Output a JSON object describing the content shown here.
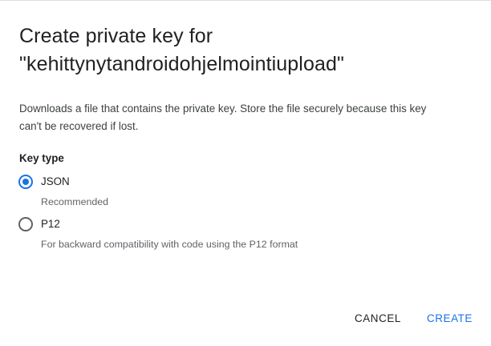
{
  "dialog": {
    "title_line1": "Create private key for",
    "title_line2": "\"kehittynytandroidohjelmointiupload\"",
    "description_line1": "Downloads a file that contains the private key. Store the file securely because this key",
    "description_line2": "can't be recovered if lost.",
    "key_type_label": "Key type",
    "options": [
      {
        "label": "JSON",
        "hint": "Recommended",
        "selected": true
      },
      {
        "label": "P12",
        "hint": "For backward compatibility with code using the P12 format",
        "selected": false
      }
    ],
    "cancel_label": "CANCEL",
    "create_label": "CREATE"
  },
  "colors": {
    "accent": "#1a73e8",
    "text_primary": "#202124",
    "text_secondary": "#5f6368"
  }
}
